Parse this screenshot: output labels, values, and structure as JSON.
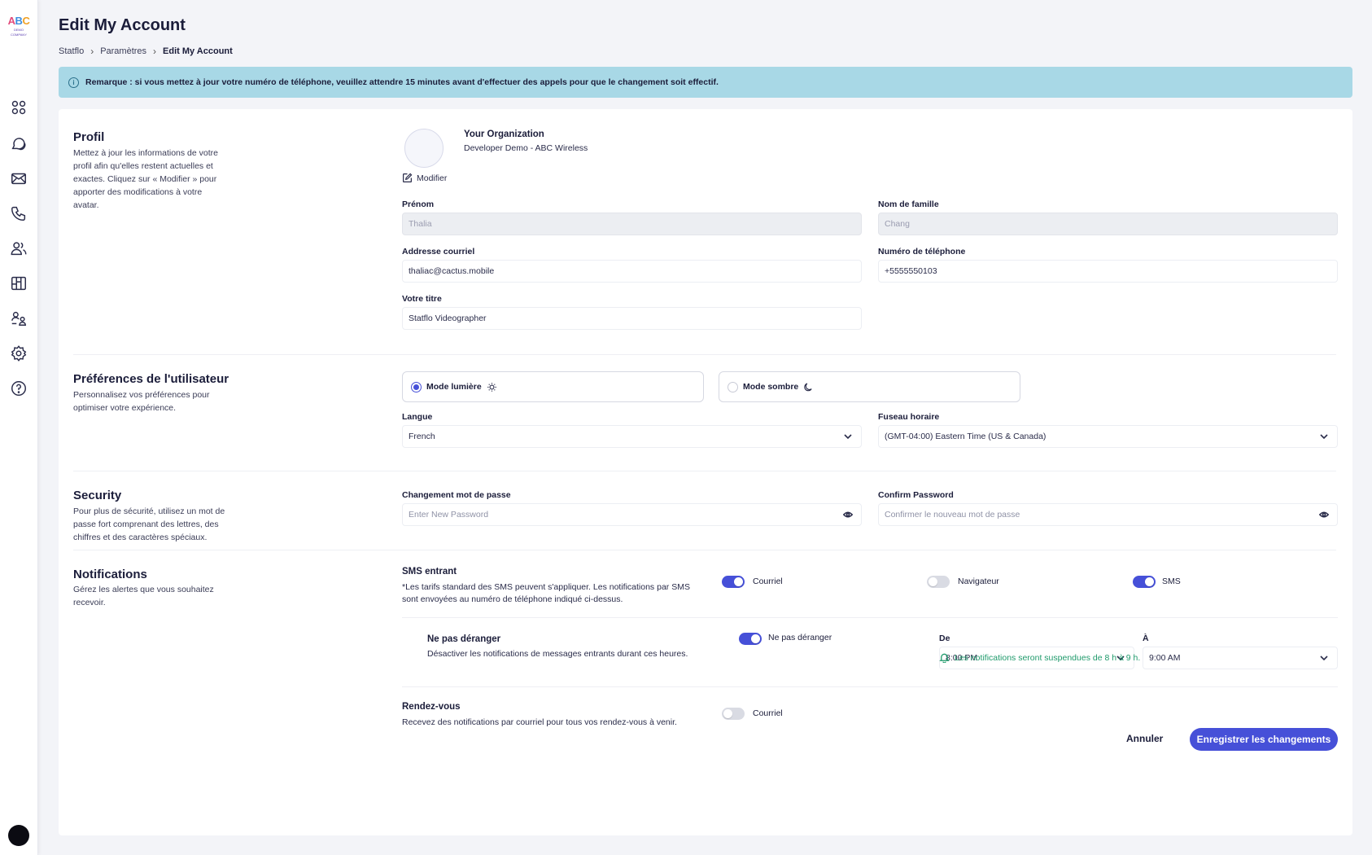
{
  "app": {
    "logo_text_a": "A",
    "logo_text_b": "B",
    "logo_text_c": "C",
    "logo_sub": "DEMO COMPANY"
  },
  "sidebar": {
    "items": [
      {
        "icon": "grid-icon"
      },
      {
        "icon": "chat-icon"
      },
      {
        "icon": "mail-icon"
      },
      {
        "icon": "phone-icon"
      },
      {
        "icon": "users-icon"
      },
      {
        "icon": "columns-icon"
      },
      {
        "icon": "user-roles-icon"
      },
      {
        "icon": "gear-icon"
      },
      {
        "icon": "help-icon"
      }
    ]
  },
  "header": {
    "title": "Edit My Account",
    "breadcrumb": [
      "Statflo",
      "Paramètres",
      "Edit My Account"
    ]
  },
  "notice": {
    "text": "Remarque : si vous mettez à jour votre numéro de téléphone, veuillez attendre 15 minutes avant d'effectuer des appels pour que le changement soit effectif."
  },
  "profile": {
    "title": "Profil",
    "description": "Mettez à jour les informations de votre profil afin qu'elles restent actuelles et exactes. Cliquez sur « Modifier » pour apporter des modifications à votre avatar.",
    "org_name": "Your Organization",
    "org_sub": "Developer Demo - ABC Wireless",
    "modify_label": "Modifier",
    "first_name_label": "Prénom",
    "first_name_value": "Thalia",
    "last_name_label": "Nom de famille",
    "last_name_value": "Chang",
    "email_label": "Addresse courriel",
    "email_value": "thaliac@cactus.mobile",
    "phone_label": "Numéro de téléphone",
    "phone_value": "+5555550103",
    "title_label": "Votre titre",
    "title_value": "Statflo Videographer"
  },
  "preferences": {
    "title": "Préférences de l'utilisateur",
    "description": "Personnalisez vos préférences pour optimiser votre expérience.",
    "light_mode_label": "Mode lumière",
    "dark_mode_label": "Mode sombre",
    "selected_mode": "light",
    "language_label": "Langue",
    "language_value": "French",
    "timezone_label": "Fuseau horaire",
    "timezone_value": "(GMT-04:00) Eastern Time (US & Canada)"
  },
  "security": {
    "title": "Security",
    "description": "Pour plus de sécurité, utilisez un mot de passe fort comprenant des lettres, des chiffres et des caractères spéciaux.",
    "new_password_label": "Changement mot de passe",
    "new_password_placeholder": "Enter New Password",
    "confirm_password_label": "Confirm Password",
    "confirm_password_placeholder": "Confirmer le nouveau mot de passe"
  },
  "notifications": {
    "title": "Notifications",
    "description": "Gérez les alertes que vous souhaitez recevoir.",
    "sms_title": "SMS entrant",
    "sms_desc": "*Les tarifs standard des SMS peuvent s'appliquer. Les notifications par SMS sont envoyées au numéro de téléphone indiqué ci-dessus.",
    "sms_toggles": [
      {
        "label": "Courriel",
        "on": true
      },
      {
        "label": "Navigateur",
        "on": false
      },
      {
        "label": "SMS",
        "on": true
      }
    ],
    "dnd_title": "Ne pas déranger",
    "dnd_desc": "Désactiver les notifications de messages entrants durant ces heures.",
    "dnd_toggle_label": "Ne pas déranger",
    "dnd_on": true,
    "from_label": "De",
    "from_value": "8:00 PM",
    "to_label": "À",
    "to_value": "9:00 AM",
    "suspend_note": "Les notifications seront suspendues de 8 h à 9 h.",
    "appt_title": "Rendez-vous",
    "appt_desc": "Recevez des notifications par courriel pour tous vos rendez-vous à venir.",
    "appt_toggle_label": "Courriel",
    "appt_on": false
  },
  "actions": {
    "cancel_label": "Annuler",
    "save_label": "Enregistrer les changements"
  },
  "colors": {
    "accent": "#4650d8",
    "notice_bg": "#a8d8e6",
    "success": "#1f9a6b"
  }
}
